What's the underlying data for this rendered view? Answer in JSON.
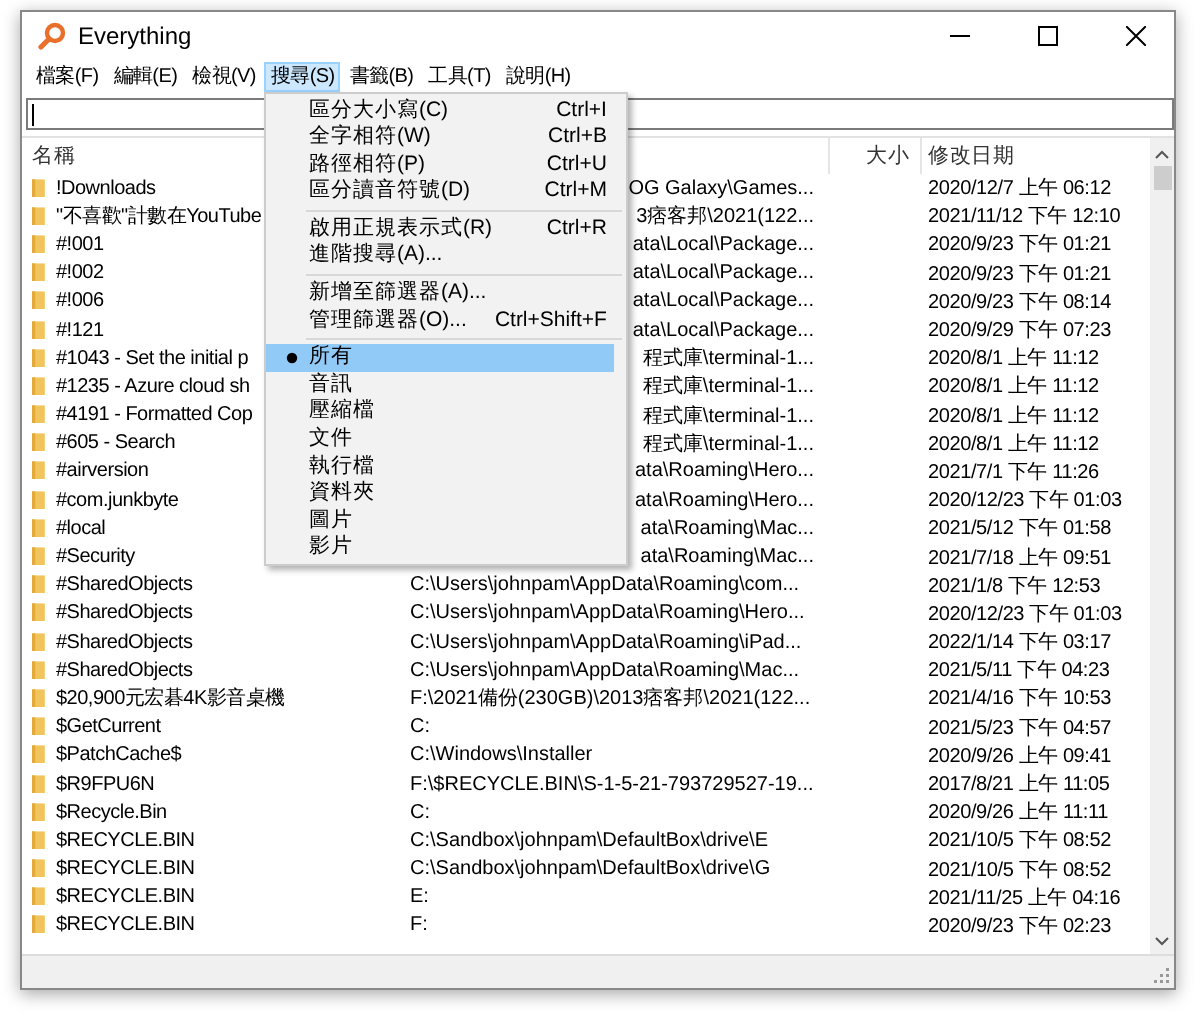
{
  "window": {
    "title": "Everything"
  },
  "menu_bar": [
    {
      "label": "檔案(F)",
      "selected": false
    },
    {
      "label": "編輯(E)",
      "selected": false
    },
    {
      "label": "檢視(V)",
      "selected": false
    },
    {
      "label": "搜尋(S)",
      "selected": true
    },
    {
      "label": "書籤(B)",
      "selected": false
    },
    {
      "label": "工具(T)",
      "selected": false
    },
    {
      "label": "說明(H)",
      "selected": false
    }
  ],
  "search_menu": [
    {
      "kind": "command",
      "label": "區分大小寫(C)",
      "shortcut": "Ctrl+I"
    },
    {
      "kind": "command",
      "label": "全字相符(W)",
      "shortcut": "Ctrl+B"
    },
    {
      "kind": "command",
      "label": "路徑相符(P)",
      "shortcut": "Ctrl+U"
    },
    {
      "kind": "command",
      "label": "區分讀音符號(D)",
      "shortcut": "Ctrl+M"
    },
    {
      "kind": "separator"
    },
    {
      "kind": "command",
      "label": "啟用正規表示式(R)",
      "shortcut": "Ctrl+R"
    },
    {
      "kind": "command",
      "label": "進階搜尋(A)..."
    },
    {
      "kind": "separator"
    },
    {
      "kind": "command",
      "label": "新增至篩選器(A)..."
    },
    {
      "kind": "command",
      "label": "管理篩選器(O)...",
      "shortcut": "Ctrl+Shift+F"
    },
    {
      "kind": "separator"
    },
    {
      "kind": "filter",
      "label": "所有",
      "selected": true
    },
    {
      "kind": "filter",
      "label": "音訊",
      "selected": false
    },
    {
      "kind": "filter",
      "label": "壓縮檔",
      "selected": false
    },
    {
      "kind": "filter",
      "label": "文件",
      "selected": false
    },
    {
      "kind": "filter",
      "label": "執行檔",
      "selected": false
    },
    {
      "kind": "filter",
      "label": "資料夾",
      "selected": false
    },
    {
      "kind": "filter",
      "label": "圖片",
      "selected": false
    },
    {
      "kind": "filter",
      "label": "影片",
      "selected": false
    }
  ],
  "table": {
    "columns": [
      "名稱",
      "大小",
      "修改日期"
    ],
    "rows": [
      {
        "name": "!Downloads",
        "path": "OG Galaxy\\Games...",
        "date": "2020/12/7 上午 06:12"
      },
      {
        "name": "\"不喜歡\"計數在YouTube",
        "path": "3痞客邦\\2021(122...",
        "date": "2021/11/12 下午 12:10"
      },
      {
        "name": "#!001",
        "path": "ata\\Local\\Package...",
        "date": "2020/9/23 下午 01:21"
      },
      {
        "name": "#!002",
        "path": "ata\\Local\\Package...",
        "date": "2020/9/23 下午 01:21"
      },
      {
        "name": "#!006",
        "path": "ata\\Local\\Package...",
        "date": "2020/9/23 下午 08:14"
      },
      {
        "name": "#!121",
        "path": "ata\\Local\\Package...",
        "date": "2020/9/29 下午 07:23"
      },
      {
        "name": "#1043 - Set the initial p",
        "path": "程式庫\\terminal-1...",
        "date": "2020/8/1 上午 11:12"
      },
      {
        "name": "#1235 - Azure cloud sh",
        "path": "程式庫\\terminal-1...",
        "date": "2020/8/1 上午 11:12"
      },
      {
        "name": "#4191 - Formatted Cop",
        "path": "程式庫\\terminal-1...",
        "date": "2020/8/1 上午 11:12"
      },
      {
        "name": "#605 - Search",
        "path": "程式庫\\terminal-1...",
        "date": "2020/8/1 上午 11:12"
      },
      {
        "name": "#airversion",
        "path": "ata\\Roaming\\Hero...",
        "date": "2021/7/1 下午 11:26"
      },
      {
        "name": "#com.junkbyte",
        "path": "ata\\Roaming\\Hero...",
        "date": "2020/12/23 下午 01:03"
      },
      {
        "name": "#local",
        "path": "ata\\Roaming\\Mac...",
        "date": "2021/5/12 下午 01:58"
      },
      {
        "name": "#Security",
        "path": "ata\\Roaming\\Mac...",
        "date": "2021/7/18 上午 09:51"
      },
      {
        "name": "#SharedObjects",
        "path": "C:\\Users\\johnpam\\AppData\\Roaming\\com...",
        "date": "2021/1/8 下午 12:53"
      },
      {
        "name": "#SharedObjects",
        "path": "C:\\Users\\johnpam\\AppData\\Roaming\\Hero...",
        "date": "2020/12/23 下午 01:03"
      },
      {
        "name": "#SharedObjects",
        "path": "C:\\Users\\johnpam\\AppData\\Roaming\\iPad...",
        "date": "2022/1/14 下午 03:17"
      },
      {
        "name": "#SharedObjects",
        "path": "C:\\Users\\johnpam\\AppData\\Roaming\\Mac...",
        "date": "2021/5/11 下午 04:23"
      },
      {
        "name": "$20,900元宏碁4K影音桌機",
        "path": "F:\\2021備份(230GB)\\2013痞客邦\\2021(122...",
        "date": "2021/4/16 下午 10:53"
      },
      {
        "name": "$GetCurrent",
        "path": "C:",
        "date": "2021/5/23 下午 04:57"
      },
      {
        "name": "$PatchCache$",
        "path": "C:\\Windows\\Installer",
        "date": "2020/9/26 上午 09:41"
      },
      {
        "name": "$R9FPU6N",
        "path": "F:\\$RECYCLE.BIN\\S-1-5-21-793729527-19...",
        "date": "2017/8/21 上午 11:05"
      },
      {
        "name": "$Recycle.Bin",
        "path": "C:",
        "date": "2020/9/26 上午 11:11"
      },
      {
        "name": "$RECYCLE.BIN",
        "path": "C:\\Sandbox\\johnpam\\DefaultBox\\drive\\E",
        "date": "2021/10/5 下午 08:52"
      },
      {
        "name": "$RECYCLE.BIN",
        "path": "C:\\Sandbox\\johnpam\\DefaultBox\\drive\\G",
        "date": "2021/10/5 下午 08:52"
      },
      {
        "name": "$RECYCLE.BIN",
        "path": "E:",
        "date": "2021/11/25 上午 04:16"
      },
      {
        "name": "$RECYCLE.BIN",
        "path": "F:",
        "date": "2020/9/23 下午 02:23"
      }
    ]
  }
}
